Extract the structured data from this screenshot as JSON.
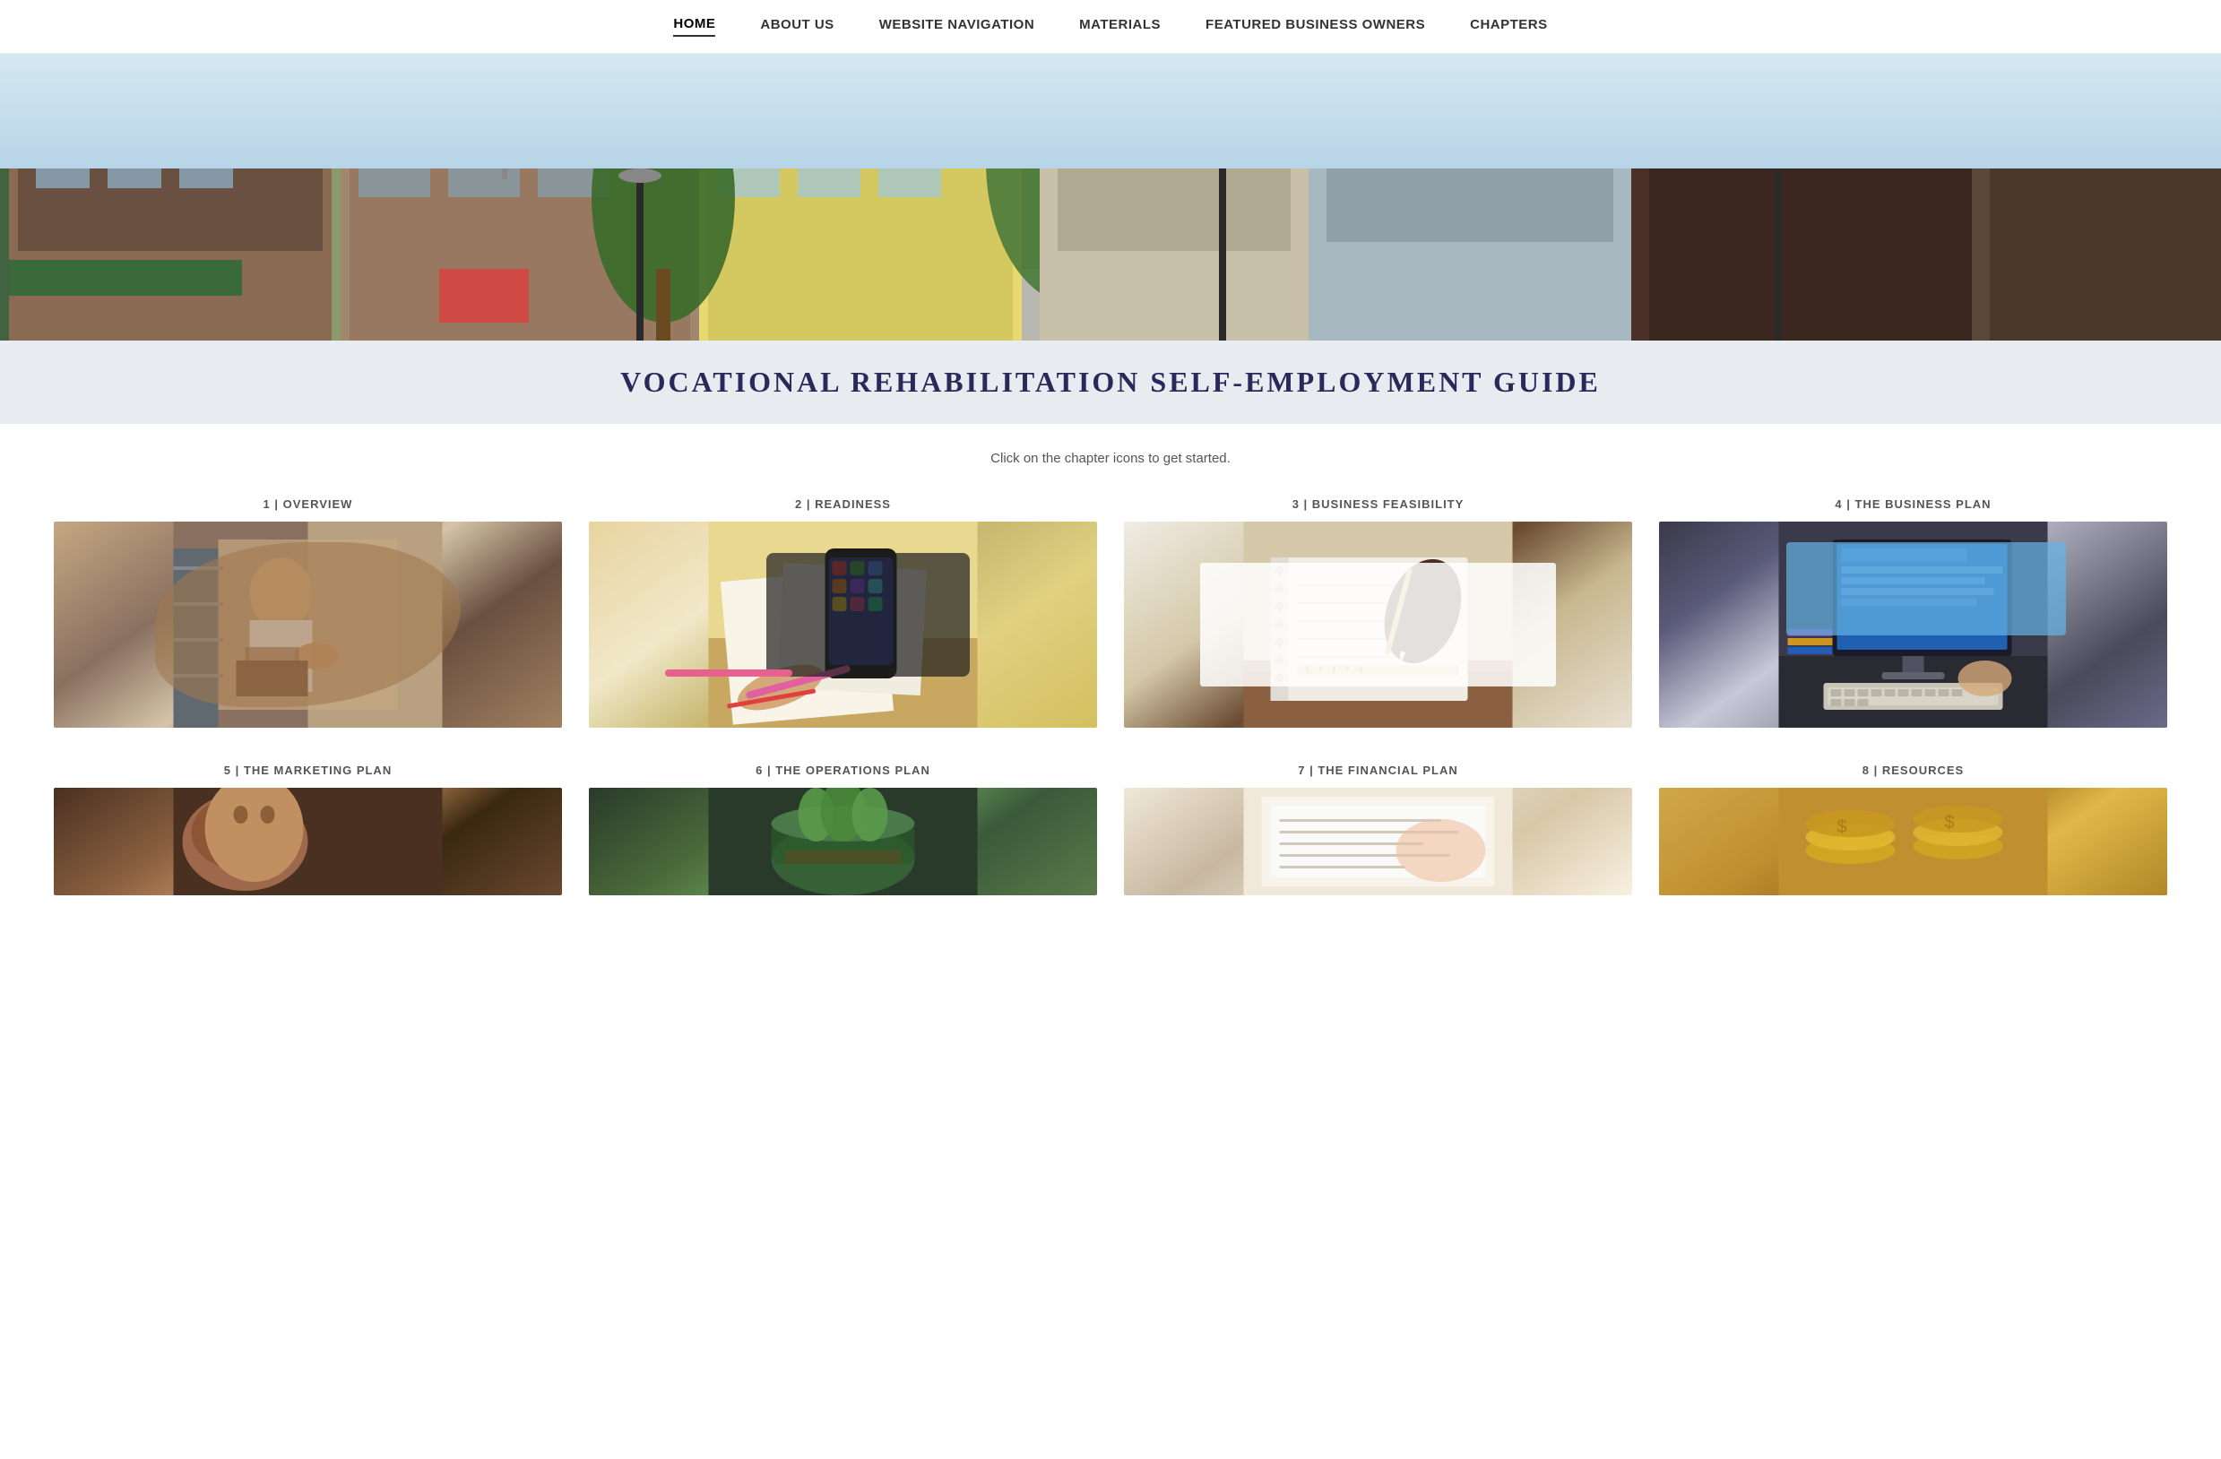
{
  "nav": {
    "items": [
      {
        "label": "HOME",
        "active": true
      },
      {
        "label": "ABOUT US",
        "active": false
      },
      {
        "label": "WEBSITE NAVIGATION",
        "active": false
      },
      {
        "label": "MATERIALS",
        "active": false
      },
      {
        "label": "FEATURED BUSINESS OWNERS",
        "active": false
      },
      {
        "label": "CHAPTERS",
        "active": false
      }
    ]
  },
  "hero": {
    "alt": "Small town main street with storefronts and trees"
  },
  "title": "VOCATIONAL REHABILITATION SELF-EMPLOYMENT GUIDE",
  "subtitle": "Click on the chapter icons to get started.",
  "chapters": [
    {
      "number": "1",
      "label": "1 | OVERVIEW",
      "imgClass": "img-ch1"
    },
    {
      "number": "2",
      "label": "2 | READINESS",
      "imgClass": "img-ch2"
    },
    {
      "number": "3",
      "label": "3 | BUSINESS FEASIBILITY",
      "imgClass": "img-ch3"
    },
    {
      "number": "4",
      "label": "4 | THE BUSINESS PLAN",
      "imgClass": "img-ch4"
    },
    {
      "number": "5",
      "label": "5 | THE MARKETING PLAN",
      "imgClass": "img-ch5"
    },
    {
      "number": "6",
      "label": "6 | THE OPERATIONS PLAN",
      "imgClass": "img-ch6"
    },
    {
      "number": "7",
      "label": "7 | THE FINANCIAL PLAN",
      "imgClass": "img-ch7"
    },
    {
      "number": "8",
      "label": "8 | RESOURCES",
      "imgClass": "img-ch8"
    }
  ]
}
